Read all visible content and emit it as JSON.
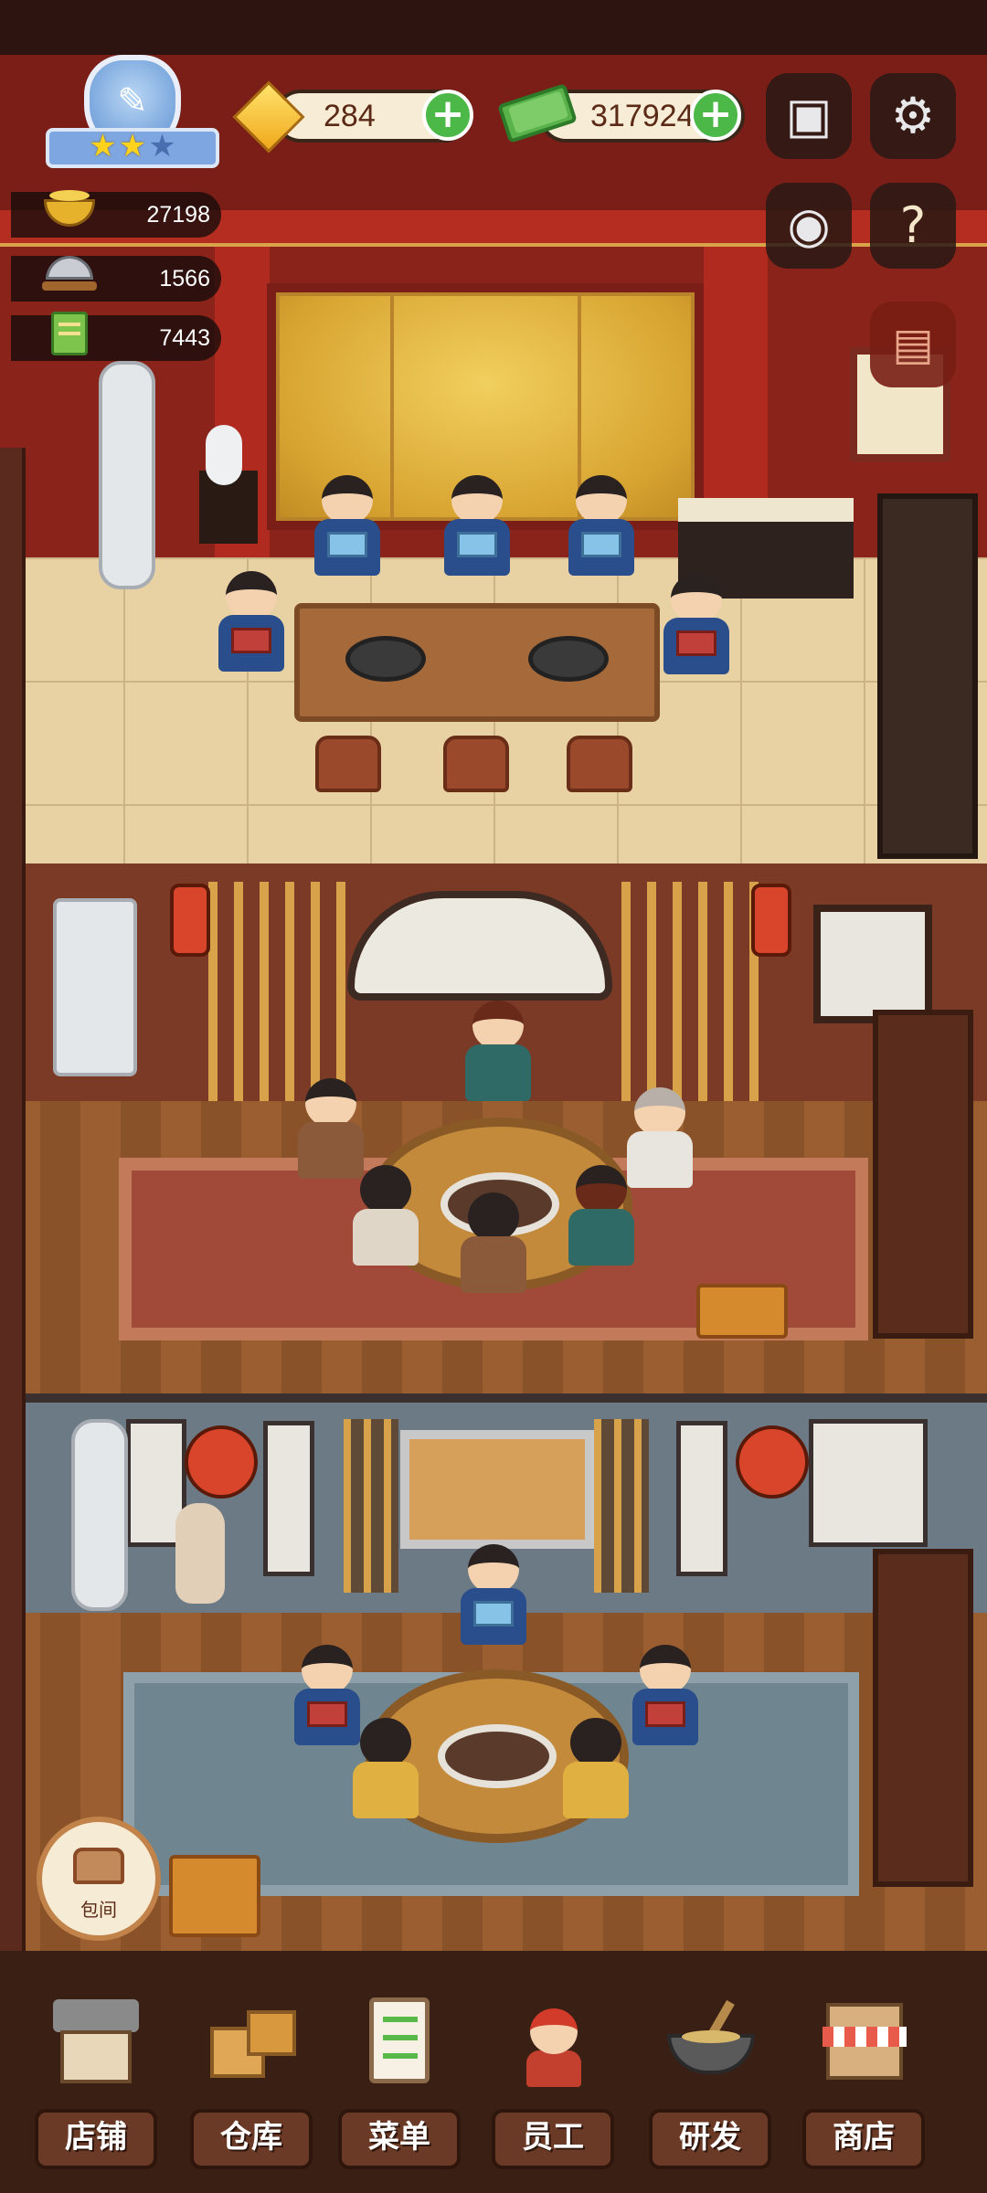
{
  "hud": {
    "gems": "284",
    "cash": "317924",
    "stat_gold": "27198",
    "stat_dish": "1566",
    "stat_recipe": "7443",
    "badge_stars": [
      "★",
      "★",
      "★"
    ]
  },
  "booth_label": "包间",
  "nav": [
    {
      "label": "店铺",
      "icon": "shop-icon"
    },
    {
      "label": "仓库",
      "icon": "warehouse-icon"
    },
    {
      "label": "菜单",
      "icon": "menu-icon"
    },
    {
      "label": "员工",
      "icon": "staff-icon"
    },
    {
      "label": "研发",
      "icon": "research-icon"
    },
    {
      "label": "商店",
      "icon": "store-icon"
    }
  ],
  "colors": {
    "plus_green": "#4cb848",
    "pill_bg": "#f7ecd6",
    "star_gold": "#ffd21e"
  }
}
